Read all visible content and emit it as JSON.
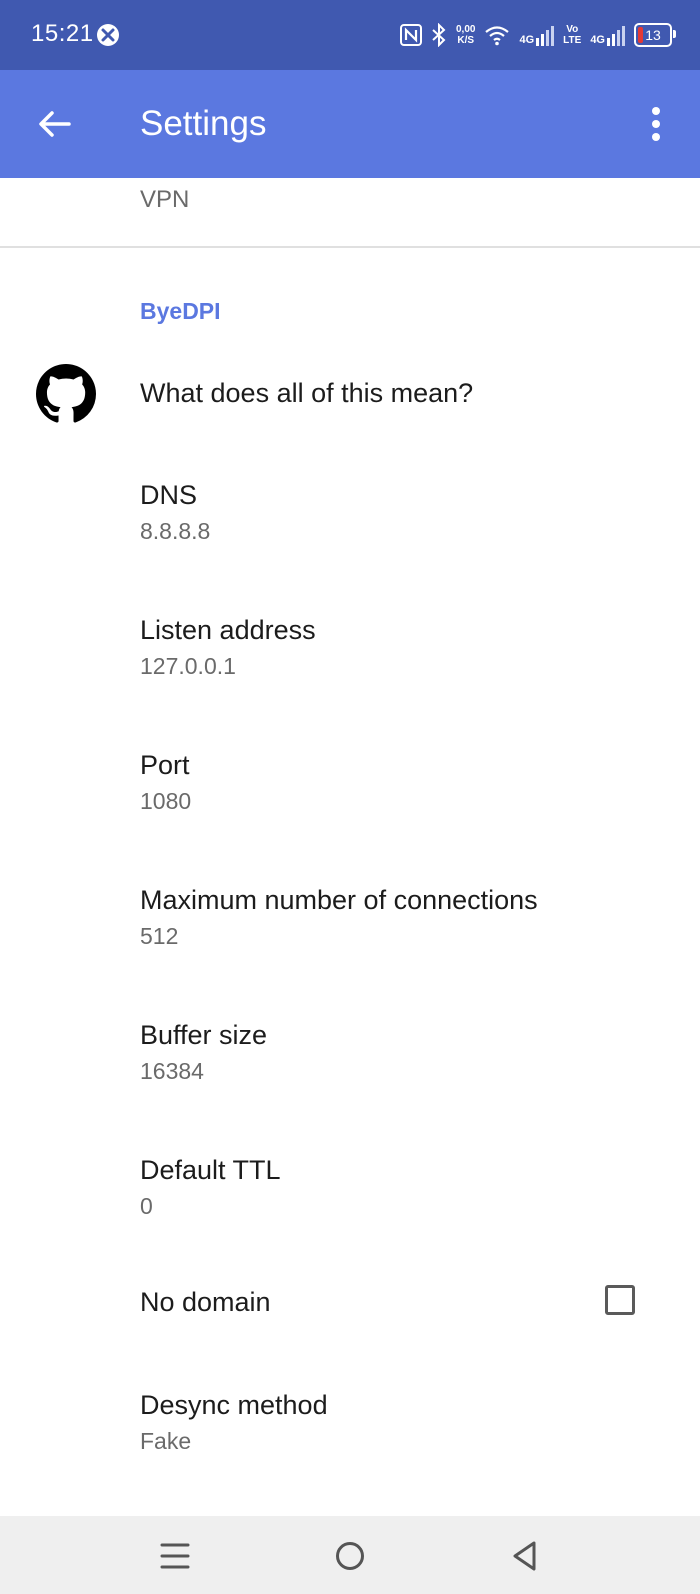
{
  "status_bar": {
    "time": "15:21",
    "net_speed_value": "0,00",
    "net_speed_unit": "K/S",
    "network_1": "4G",
    "volte_top": "Vo",
    "volte_bottom": "LTE",
    "network_2": "4G",
    "battery_level": "13"
  },
  "app_bar": {
    "title": "Settings"
  },
  "vpn_summary": "VPN",
  "category": "ByeDPI",
  "prefs": {
    "github": {
      "title": "What does all of this mean?"
    },
    "dns": {
      "title": "DNS",
      "summary": "8.8.8.8"
    },
    "listen_address": {
      "title": "Listen address",
      "summary": "127.0.0.1"
    },
    "port": {
      "title": "Port",
      "summary": "1080"
    },
    "max_connections": {
      "title": "Maximum number of connections",
      "summary": "512"
    },
    "buffer_size": {
      "title": "Buffer size",
      "summary": "16384"
    },
    "default_ttl": {
      "title": "Default TTL",
      "summary": "0"
    },
    "no_domain": {
      "title": "No domain",
      "checked": false
    },
    "desync_method": {
      "title": "Desync method",
      "summary": "Fake"
    }
  },
  "colors": {
    "status_bar": "#4059b0",
    "app_bar": "#5b78e0",
    "accent": "#5b78e0",
    "nav_bar": "#efefef"
  },
  "icons": {
    "back": "arrow-left-icon",
    "more": "more-vert-icon",
    "github": "github-icon",
    "nav_recents": "menu-icon",
    "nav_home": "circle-home-icon",
    "nav_back": "triangle-back-icon"
  }
}
